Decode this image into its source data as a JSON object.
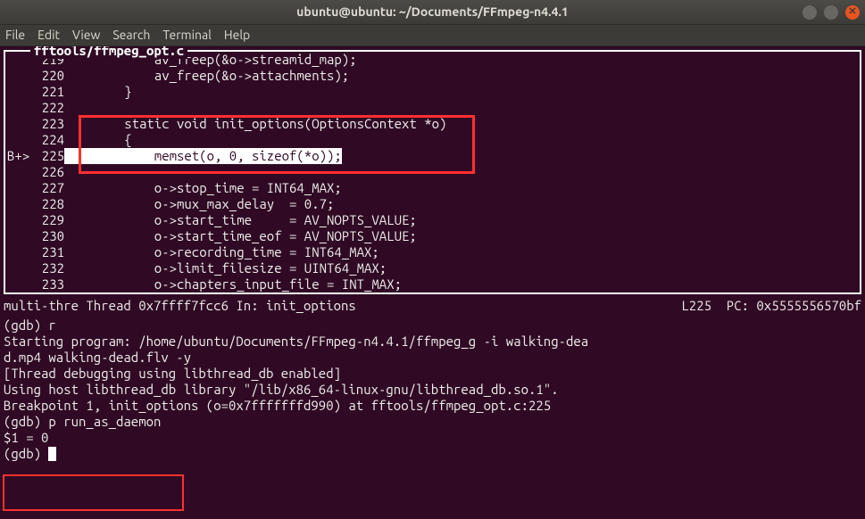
{
  "window": {
    "title": "ubuntu@ubuntu: ~/Documents/FFmpeg-n4.4.1"
  },
  "menubar": {
    "items": [
      "File",
      "Edit",
      "View",
      "Search",
      "Terminal",
      "Help"
    ]
  },
  "source": {
    "file_label": "fftools/ffmpeg_opt.c",
    "lines": [
      {
        "mark": "",
        "num": "219",
        "code": "            av_freep(&o->streamid_map);",
        "hl": false
      },
      {
        "mark": "",
        "num": "220",
        "code": "            av_freep(&o->attachments);",
        "hl": false
      },
      {
        "mark": "",
        "num": "221",
        "code": "        }",
        "hl": false
      },
      {
        "mark": "",
        "num": "222",
        "code": "",
        "hl": false
      },
      {
        "mark": "",
        "num": "223",
        "code": "        static void init_options(OptionsContext *o)",
        "hl": false
      },
      {
        "mark": "",
        "num": "224",
        "code": "        {",
        "hl": false
      },
      {
        "mark": "B+>",
        "num": "225",
        "code": "            memset(o, 0, sizeof(*o));",
        "hl": true
      },
      {
        "mark": "",
        "num": "226",
        "code": "",
        "hl": false
      },
      {
        "mark": "",
        "num": "227",
        "code": "            o->stop_time = INT64_MAX;",
        "hl": false
      },
      {
        "mark": "",
        "num": "228",
        "code": "            o->mux_max_delay  = 0.7;",
        "hl": false
      },
      {
        "mark": "",
        "num": "229",
        "code": "            o->start_time     = AV_NOPTS_VALUE;",
        "hl": false
      },
      {
        "mark": "",
        "num": "230",
        "code": "            o->start_time_eof = AV_NOPTS_VALUE;",
        "hl": false
      },
      {
        "mark": "",
        "num": "231",
        "code": "            o->recording_time = INT64_MAX;",
        "hl": false
      },
      {
        "mark": "",
        "num": "232",
        "code": "            o->limit_filesize = UINT64_MAX;",
        "hl": false
      },
      {
        "mark": "",
        "num": "233",
        "code": "            o->chapters_input_file = INT_MAX;",
        "hl": false
      }
    ]
  },
  "status": {
    "left": "multi-thre Thread 0x7ffff7fcc6 In: init_options",
    "right": "L225  PC: 0x5555556570bf"
  },
  "gdb": {
    "lines": [
      "(gdb) r",
      "Starting program: /home/ubuntu/Documents/FFmpeg-n4.4.1/ffmpeg_g -i walking-dea",
      "d.mp4 walking-dead.flv -y",
      "[Thread debugging using libthread_db enabled]",
      "Using host libthread_db library \"/lib/x86_64-linux-gnu/libthread_db.so.1\".",
      "",
      "Breakpoint 1, init_options (o=0x7fffffffd990) at fftools/ffmpeg_opt.c:225",
      "(gdb) p run_as_daemon",
      "$1 = 0",
      "(gdb) "
    ]
  }
}
